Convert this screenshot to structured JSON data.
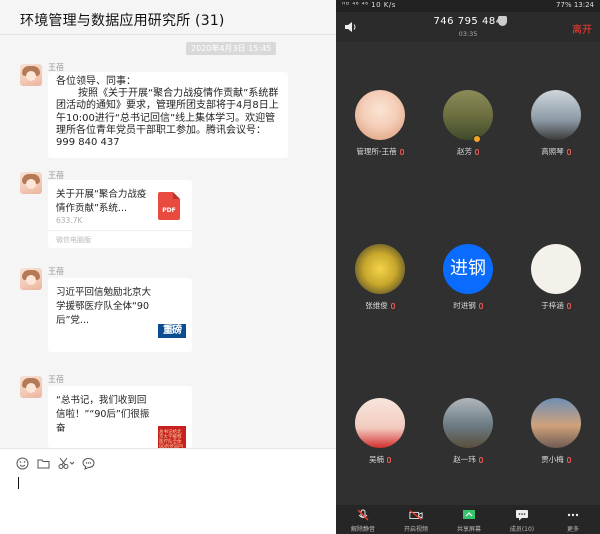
{
  "chat": {
    "title": "环境管理与数据应用研究所 (31)",
    "timestamp": "2020年4月3日 15:45",
    "messages": [
      {
        "sender": "王蓓",
        "lines": [
          "各位领导、同事：",
          "按照《关于开展“聚合力战疫情作贡献”系统群团活动的通知》要求，管理所团支部将于4月8日上午10:00进行“总书记回信”线上集体学习。欢迎管理所各位青年党员干部职工参加。腾讯会议号：999 840 437"
        ]
      },
      {
        "sender": "王蓓",
        "card_text": "关于开展“聚合力战疫情作贡献”系统...",
        "card_size": "633.7K",
        "card_source": "微信电脑版",
        "icon_label": "PDF"
      },
      {
        "sender": "王蓓",
        "card_text": "习近平回信勉励北京大学援鄂医疗队全体“90后”党...",
        "thumb_text": "重磅"
      },
      {
        "sender": "王蓓",
        "card_text": "“总书记，我们收到回信啦！”“90后”们很振奋",
        "thumb_text": "总书记给北京大学援鄂医疗队全体90后党员回信"
      }
    ],
    "toolbar_icons": [
      "emoji-icon",
      "folder-icon",
      "scissors-icon",
      "chat-bubble-icon"
    ]
  },
  "meeting": {
    "status_left": "ᴴᴰ ⁴⁶ ⁴⁶ 10 K/s",
    "status_right": "77% 13:24",
    "meeting_id": "746 795 484",
    "duration": "03:35",
    "leave_label": "离开",
    "participants": [
      {
        "name": "管理所-王蓓"
      },
      {
        "name": "赵芳"
      },
      {
        "name": "高照琴"
      },
      {
        "name": "张维俊"
      },
      {
        "name": "时进钢",
        "avatar_text": "进钢"
      },
      {
        "name": "于梓涵"
      },
      {
        "name": "吴楠"
      },
      {
        "name": "赵一玮"
      },
      {
        "name": "贾小梅"
      }
    ],
    "bottom_buttons": [
      {
        "label": "解除静音"
      },
      {
        "label": "开启视频"
      },
      {
        "label": "共享屏幕"
      },
      {
        "label": "成员(10)"
      },
      {
        "label": "更多"
      }
    ],
    "colors": {
      "leave": "#ff3b30",
      "accent_blue": "#0a6cff",
      "mic_muted": "#e85a4f"
    }
  }
}
